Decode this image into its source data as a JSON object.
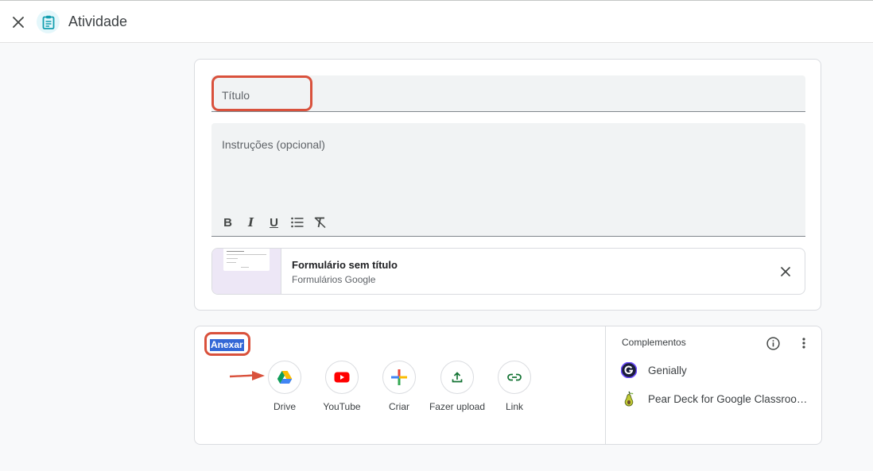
{
  "header": {
    "title": "Atividade",
    "close_icon": "close-icon",
    "assignment_icon": "assignment-icon",
    "accent_color": "#129eaf"
  },
  "form": {
    "title_placeholder": "Título",
    "instructions_placeholder": "Instruções (opcional)",
    "format_toolbar": {
      "bold": "B",
      "italic": "I",
      "underline": "U",
      "bulleted_list_icon": "bulleted-list-icon",
      "clear_format_icon": "clear-format-icon"
    },
    "attachment": {
      "title": "Formulário sem título",
      "subtitle": "Formulários Google",
      "remove_icon": "close-icon"
    }
  },
  "attach": {
    "label": "Anexar",
    "options": [
      {
        "label": "Drive",
        "icon": "google-drive-icon"
      },
      {
        "label": "YouTube",
        "icon": "youtube-icon"
      },
      {
        "label": "Criar",
        "icon": "create-plus-icon"
      },
      {
        "label": "Fazer upload",
        "icon": "upload-icon"
      },
      {
        "label": "Link",
        "icon": "link-icon"
      }
    ]
  },
  "addons": {
    "title": "Complementos",
    "info_icon": "info-icon",
    "more_icon": "more-vert-icon",
    "items": [
      {
        "label": "Genially",
        "icon": "genially-icon"
      },
      {
        "label": "Pear Deck for Google Classroo…",
        "icon": "pear-deck-icon"
      }
    ]
  },
  "annotations": {
    "highlight_color": "#d9513c"
  }
}
